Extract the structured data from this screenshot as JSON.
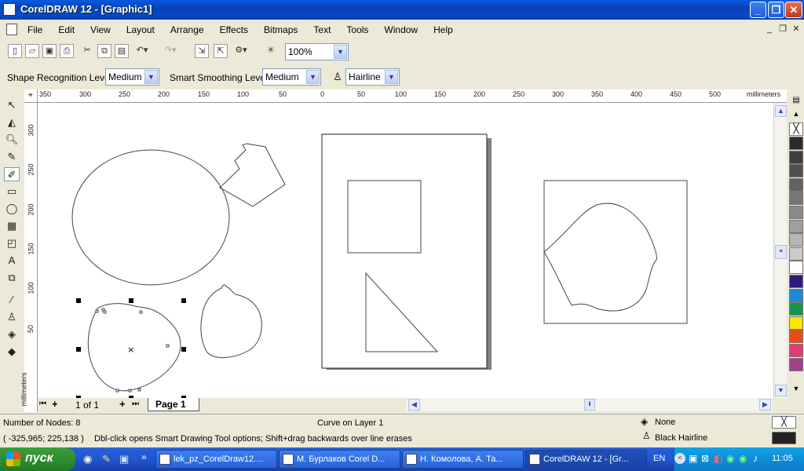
{
  "window": {
    "title": "CorelDRAW 12 - [Graphic1]"
  },
  "menu": [
    "File",
    "Edit",
    "View",
    "Layout",
    "Arrange",
    "Effects",
    "Bitmaps",
    "Text",
    "Tools",
    "Window",
    "Help"
  ],
  "toolbar": {
    "zoom": "100%"
  },
  "propbar": {
    "shape_label": "Shape Recognition Level:",
    "shape_value": "Medium",
    "smooth_label": "Smart Smoothing Level:",
    "smooth_value": "Medium",
    "outline_value": "Hairline"
  },
  "ruler": {
    "h_ticks": [
      "350",
      "300",
      "250",
      "200",
      "150",
      "100",
      "50",
      "0",
      "50",
      "100",
      "150",
      "200",
      "250",
      "300",
      "350",
      "400",
      "450",
      "500"
    ],
    "h_unit": "millimeters",
    "v_ticks": [
      "300",
      "250",
      "200",
      "150",
      "100",
      "50"
    ],
    "v_unit": "millimeters"
  },
  "pages": {
    "counter": "1 of 1",
    "tab": "Page 1"
  },
  "status": {
    "nodes": "Number of Nodes: 8",
    "layer": "Curve on Layer 1",
    "fill": "None",
    "outline": "Black  Hairline",
    "coords": "( -325,965; 225,138 )",
    "hint": "Dbl-click opens Smart Drawing Tool options; Shift+drag backwards over line erases"
  },
  "palette": [
    "#2b2b2b",
    "#3d3d3d",
    "#4f4f4f",
    "#626262",
    "#767676",
    "#8a8a8a",
    "#9f9f9f",
    "#b5b5b5",
    "#cbcbcb",
    "#ffffff",
    "#2e1a7e",
    "#1c8ad4",
    "#17954a",
    "#ffe600",
    "#ee4a12",
    "#e23b70",
    "#a43f8a"
  ],
  "taskbar": {
    "start": "пуск",
    "tasks": [
      "lek_pz_CorelDraw12....",
      "М. Бурлаков Corel D...",
      "Н. Комолова, А. Та...",
      "CorelDRAW 12 - [Gr..."
    ],
    "lang": "EN",
    "clock": "11:05"
  }
}
